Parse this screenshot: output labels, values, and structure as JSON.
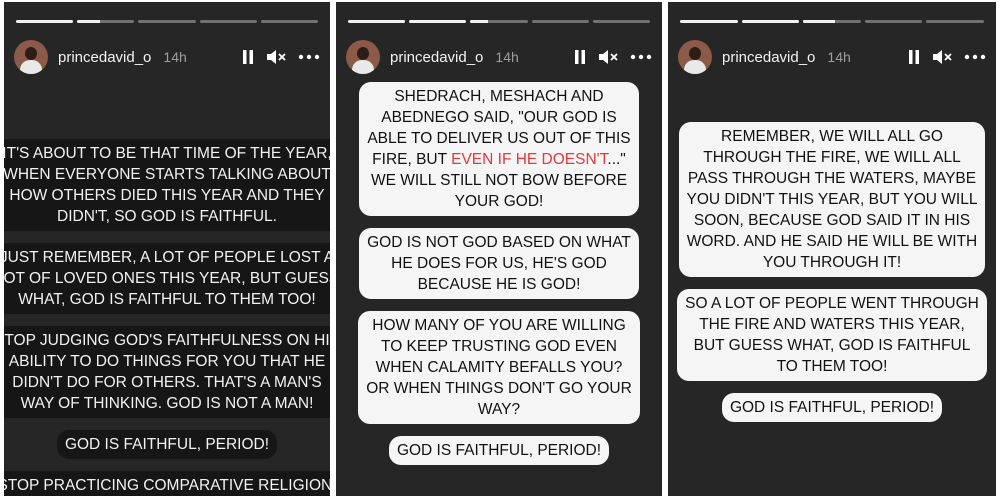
{
  "stories": [
    {
      "username": "princedavid_o",
      "time": "14h",
      "progress": [
        1,
        0.4,
        0,
        0,
        0
      ],
      "blocks": [
        {
          "lines": [
            "IT'S ABOUT TO BE THAT TIME OF THE YEAR,",
            "WHEN EVERYONE STARTS TALKING ABOUT",
            "HOW OTHERS DIED THIS YEAR AND THEY",
            "DIDN'T, SO GOD IS FAITHFUL."
          ]
        },
        {
          "lines": [
            "JUST REMEMBER, A LOT OF PEOPLE LOST A",
            "LOT OF LOVED ONES THIS YEAR, BUT GUESS",
            "WHAT, GOD IS FAITHFUL TO THEM TOO!"
          ]
        },
        {
          "lines": [
            "STOP JUDGING GOD'S FAITHFULNESS ON HIS",
            "ABILITY TO DO THINGS FOR YOU THAT HE",
            "DIDN'T DO FOR OTHERS. THAT'S A MAN'S",
            "WAY OF THINKING.  GOD IS NOT A MAN!"
          ]
        },
        {
          "lines": [
            "GOD IS FAITHFUL, PERIOD!"
          ]
        },
        {
          "lines": [
            "STOP PRACTICING COMPARATIVE RELIGION!"
          ]
        }
      ]
    },
    {
      "username": "princedavid_o",
      "time": "14h",
      "progress": [
        1,
        1,
        0.3,
        0,
        0
      ],
      "blocks": [
        {
          "lines": [
            "SHEDRACH, MESHACH AND",
            "ABEDNEGO SAID, \"OUR GOD IS",
            "ABLE TO DELIVER US OUT OF THIS"
          ],
          "line4_pre": "FIRE, BUT ",
          "line4_red": "EVEN IF HE DOESN'T",
          "line4_post": "...\"",
          "lines_after": [
            "WE WILL STILL NOT BOW BEFORE",
            "YOUR GOD!"
          ]
        },
        {
          "lines": [
            "GOD IS NOT GOD BASED ON WHAT",
            "HE DOES FOR US, HE'S GOD",
            "BECAUSE HE IS GOD!"
          ]
        },
        {
          "lines": [
            "HOW MANY OF YOU ARE WILLING",
            "TO KEEP TRUSTING GOD EVEN",
            "WHEN CALAMITY BEFALLS YOU?",
            "OR WHEN THINGS DON'T GO YOUR",
            "WAY?"
          ]
        },
        {
          "lines": [
            "GOD IS FAITHFUL, PERIOD!"
          ]
        }
      ]
    },
    {
      "username": "princedavid_o",
      "time": "14h",
      "progress": [
        1,
        1,
        0.55,
        0,
        0
      ],
      "blocks": [
        {
          "lines": [
            "REMEMBER, WE WILL ALL GO",
            "THROUGH THE FIRE, WE WILL ALL",
            "PASS THROUGH THE WATERS, MAYBE",
            "YOU DIDN'T THIS YEAR, BUT YOU WILL",
            "SOON, BECAUSE GOD SAID IT IN HIS",
            "WORD. AND HE SAID HE WILL BE WITH",
            "YOU THROUGH IT!"
          ]
        },
        {
          "lines": [
            "SO A LOT OF PEOPLE WENT THROUGH",
            "THE FIRE AND WATERS THIS YEAR,",
            "BUT GUESS WHAT, GOD IS FAITHFUL",
            "TO THEM TOO!"
          ]
        },
        {
          "lines": [
            "GOD IS FAITHFUL, PERIOD!"
          ]
        }
      ]
    }
  ],
  "icons": {
    "pause": "pause-icon",
    "mute": "mute-icon",
    "more": "more-options-icon"
  },
  "colors": {
    "panel": "#262626",
    "box": "#f5f5f5",
    "highlight": "#e03a3a"
  }
}
